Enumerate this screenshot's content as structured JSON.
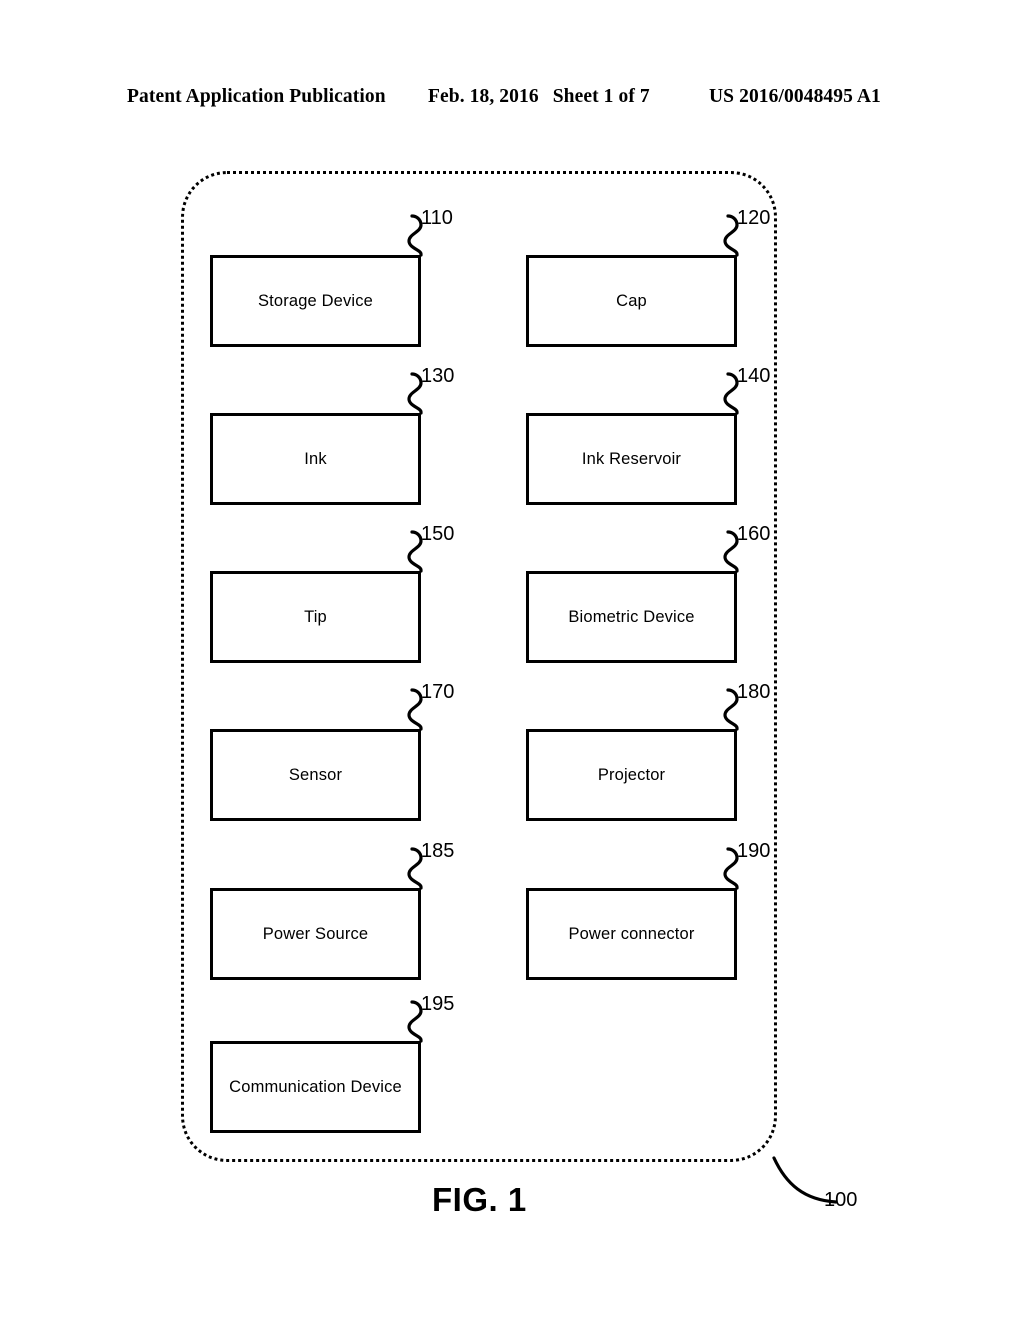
{
  "header": {
    "publication": "Patent Application Publication",
    "date": "Feb. 18, 2016",
    "sheet": "Sheet 1 of 7",
    "doc_number": "US 2016/0048495 A1"
  },
  "figure": {
    "caption": "FIG. 1",
    "assembly_ref": "100"
  },
  "components": [
    {
      "label": "Storage Device",
      "ref": "110"
    },
    {
      "label": "Cap",
      "ref": "120"
    },
    {
      "label": "Ink",
      "ref": "130"
    },
    {
      "label": "Ink Reservoir",
      "ref": "140"
    },
    {
      "label": "Tip",
      "ref": "150"
    },
    {
      "label": "Biometric Device",
      "ref": "160"
    },
    {
      "label": "Sensor",
      "ref": "170"
    },
    {
      "label": "Projector",
      "ref": "180"
    },
    {
      "label": "Power Source",
      "ref": "185"
    },
    {
      "label": "Power connector",
      "ref": "190"
    },
    {
      "label": "Communication Device",
      "ref": "195"
    }
  ],
  "colors": {
    "ink": "#000000",
    "paper": "#ffffff"
  }
}
